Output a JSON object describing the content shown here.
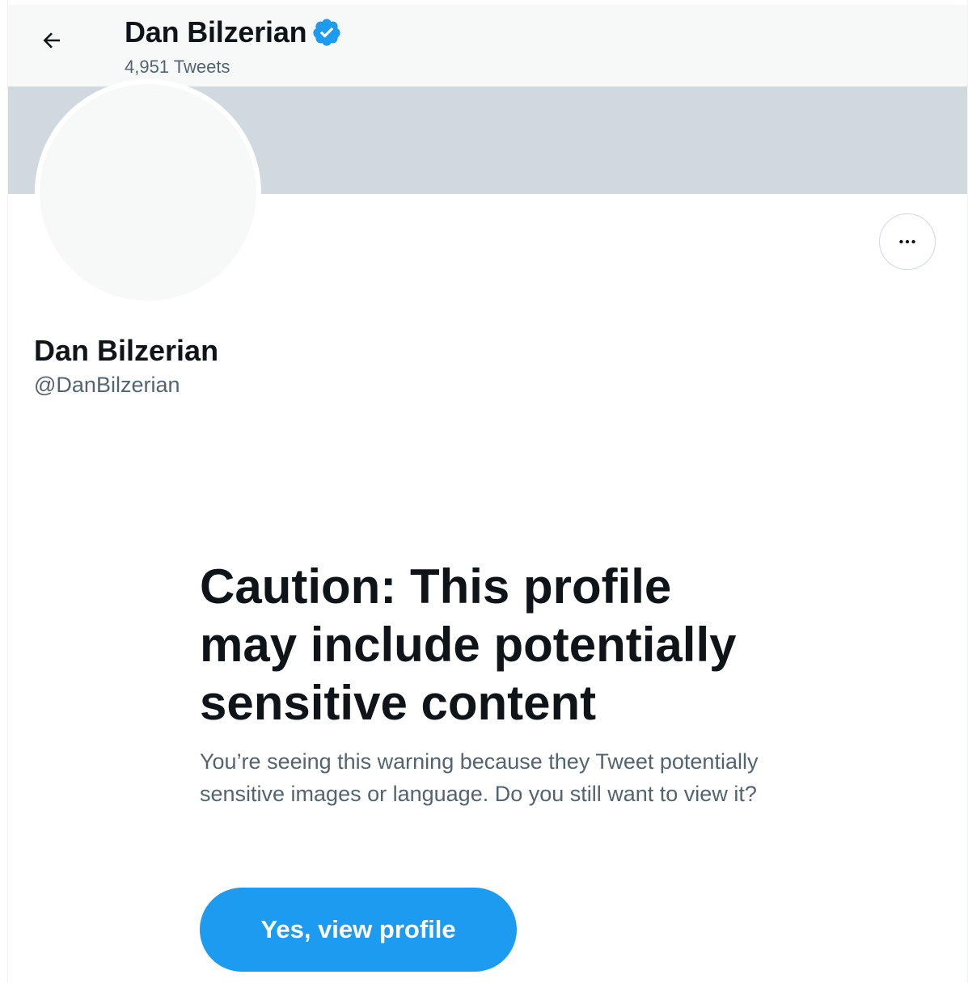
{
  "header": {
    "back_icon": "arrow-left-icon",
    "name": "Dan Bilzerian",
    "verified_icon": "verified-badge-icon",
    "tweet_count": "4,951 Tweets"
  },
  "profile": {
    "more_icon": "more-options-icon",
    "name": "Dan Bilzerian",
    "handle": "@DanBilzerian"
  },
  "warning": {
    "title": "Caution: This profile may include potentially sensitive content",
    "body": "You’re seeing this warning because they Tweet potentially sensitive images or language. Do you still want to view it?",
    "button_label": "Yes, view profile"
  },
  "colors": {
    "accent": "#1d9bf0",
    "banner": "#cfd9de",
    "header_bg": "#f7f9f9",
    "primary_text": "#0f1419",
    "secondary_text": "#536471"
  }
}
